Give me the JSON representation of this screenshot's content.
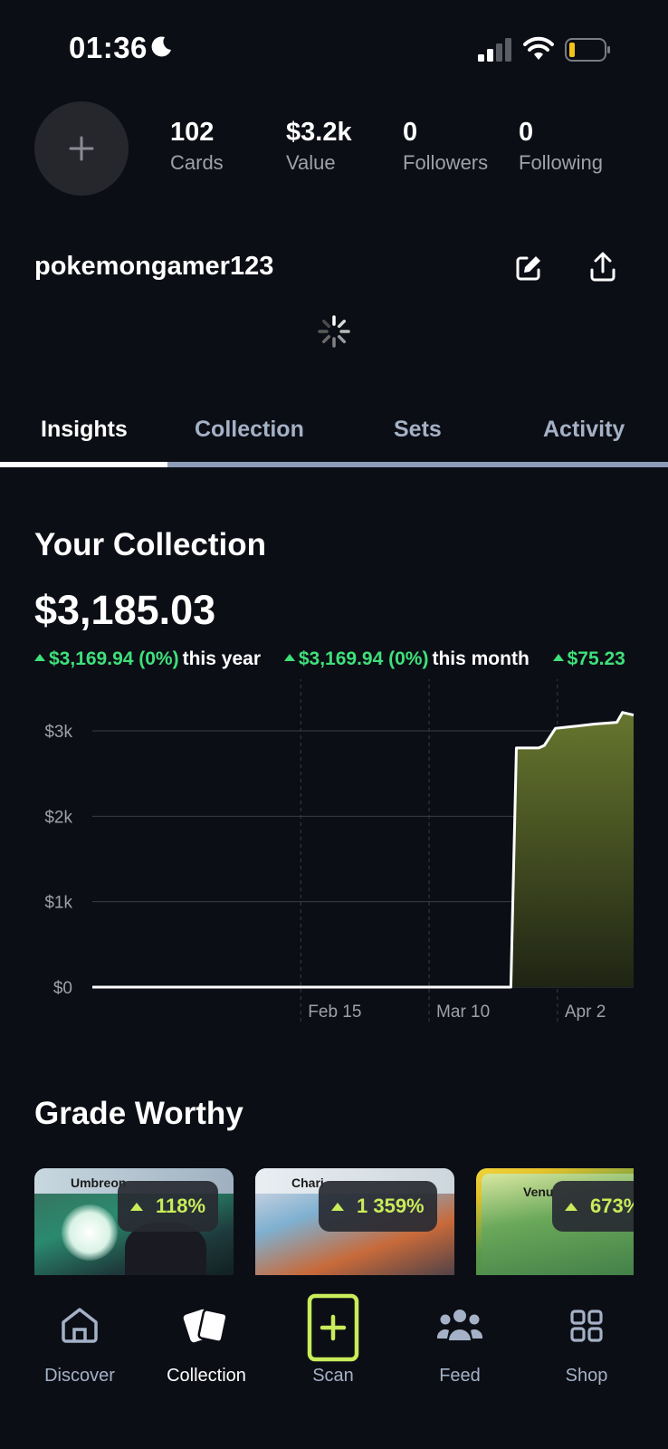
{
  "status_bar": {
    "time": "01:36"
  },
  "profile": {
    "username": "pokemongamer123",
    "stats": [
      {
        "value": "102",
        "label": "Cards"
      },
      {
        "value": "$3.2k",
        "label": "Value"
      },
      {
        "value": "0",
        "label": "Followers"
      },
      {
        "value": "0",
        "label": "Following"
      }
    ]
  },
  "tabs": [
    "Insights",
    "Collection",
    "Sets",
    "Activity"
  ],
  "active_tab": "Insights",
  "collection": {
    "title": "Your Collection",
    "total": "$3,185.03",
    "changes": [
      {
        "amount": "$3,169.94 (0%)",
        "period": "this year"
      },
      {
        "amount": "$3,169.94 (0%)",
        "period": "this month"
      },
      {
        "amount": "$75.23",
        "period": ""
      }
    ]
  },
  "chart_data": {
    "type": "area",
    "y_ticks": [
      "$3k",
      "$2k",
      "$1k",
      "$0"
    ],
    "x_ticks": [
      "Feb 15",
      "Mar 10",
      "Apr 2"
    ],
    "ylim": [
      0,
      3500
    ],
    "x_domain_days": [
      0,
      97
    ],
    "grid": true,
    "line_color": "#ffffff",
    "fill_color": "#67762e",
    "points": [
      {
        "day": 0,
        "value": 0
      },
      {
        "day": 75,
        "value": 0
      },
      {
        "day": 76,
        "value": 2800
      },
      {
        "day": 80,
        "value": 2800
      },
      {
        "day": 81,
        "value": 2830
      },
      {
        "day": 83,
        "value": 3030
      },
      {
        "day": 86,
        "value": 3050
      },
      {
        "day": 90,
        "value": 3080
      },
      {
        "day": 94,
        "value": 3100
      },
      {
        "day": 95,
        "value": 3215
      },
      {
        "day": 97,
        "value": 3185
      }
    ]
  },
  "grade_worthy": {
    "title": "Grade Worthy",
    "cards": [
      {
        "name": "Umbreon",
        "change": "118%"
      },
      {
        "name": "Chari",
        "change": "1 359%"
      },
      {
        "name": "Venu",
        "change": "673%"
      }
    ]
  },
  "nav": [
    {
      "label": "Discover",
      "icon": "home-icon",
      "active": false
    },
    {
      "label": "Collection",
      "icon": "cards-icon",
      "active": true
    },
    {
      "label": "Scan",
      "icon": "scan-plus-icon",
      "active": false
    },
    {
      "label": "Feed",
      "icon": "people-icon",
      "active": false
    },
    {
      "label": "Shop",
      "icon": "grid-icon",
      "active": false
    }
  ],
  "colors": {
    "background": "#0c0e15",
    "positive": "#3ee07a",
    "accent": "#c9ec5a",
    "muted": "#a4b1c6"
  }
}
